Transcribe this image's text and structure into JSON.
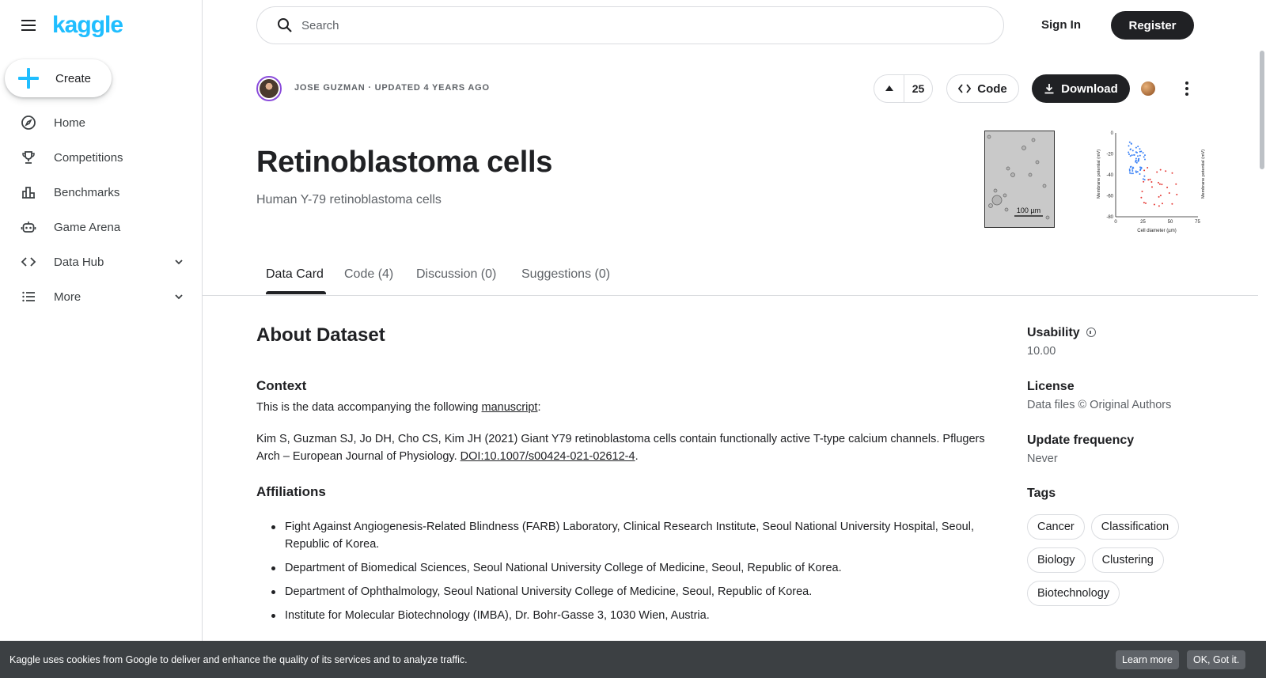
{
  "app": {
    "logo": "kaggle"
  },
  "sidebar": {
    "create_label": "Create",
    "items": [
      {
        "label": "Home",
        "icon": "compass-icon"
      },
      {
        "label": "Competitions",
        "icon": "trophy-icon"
      },
      {
        "label": "Benchmarks",
        "icon": "bar-chart-icon"
      },
      {
        "label": "Game Arena",
        "icon": "robot-icon"
      },
      {
        "label": "Data Hub",
        "icon": "code-icon",
        "expandable": true
      },
      {
        "label": "More",
        "icon": "list-icon",
        "expandable": true
      }
    ]
  },
  "topbar": {
    "search_placeholder": "Search",
    "signin_label": "Sign In",
    "register_label": "Register"
  },
  "dataset": {
    "author": "JOSE GUZMAN",
    "updated": "· UPDATED 4 YEARS AGO",
    "upvotes": "25",
    "code_label": "Code",
    "download_label": "Download",
    "title": "Retinoblastoma cells",
    "subtitle": "Human Y-79 retinoblastoma cells",
    "thumb_scale_label": "100 µm",
    "thumb_chart": {
      "ylabel": "Membrane potential (mV)",
      "xlabel": "Cell diameter (µm)",
      "yticks": [
        "0",
        "-20",
        "-40",
        "-60",
        "-80"
      ],
      "xticks": [
        "0",
        "25",
        "50",
        "75"
      ],
      "colors": {
        "blue": "#3b82f6",
        "red": "#e53935"
      }
    }
  },
  "tabs": [
    {
      "label": "Data Card",
      "active": true
    },
    {
      "label": "Code (4)",
      "active": false
    },
    {
      "label": "Discussion (0)",
      "active": false
    },
    {
      "label": "Suggestions (0)",
      "active": false
    }
  ],
  "about": {
    "heading": "About Dataset",
    "context_heading": "Context",
    "context_text_before": "This is the data accompanying the following ",
    "context_link": "manuscript",
    "context_text_after": ":",
    "citation_text": "Kim S, Guzman SJ, Jo DH, Cho CS, Kim JH (2021) Giant Y79 retinoblastoma cells contain functionally active T-type calcium channels. Pflugers Arch – European Journal of Physiology. ",
    "citation_link": "DOI:10.1007/s00424-021-02612-4",
    "citation_end": ".",
    "affiliations_heading": "Affiliations",
    "affiliations": [
      "Fight Against Angiogenesis-Related Blindness (FARB) Laboratory, Clinical Research Institute, Seoul National University Hospital, Seoul, Republic of Korea.",
      "Department of Biomedical Sciences, Seoul National University College of Medicine, Seoul, Republic of Korea.",
      "Department of Ophthalmology, Seoul National University College of Medicine, Seoul, Republic of Korea.",
      "Institute for Molecular Biotechnology (IMBA), Dr. Bohr-Gasse 3, 1030 Wien, Austria."
    ]
  },
  "meta": {
    "usability_label": "Usability",
    "usability_value": "10.00",
    "license_label": "License",
    "license_value": "Data files © Original Authors",
    "update_label": "Update frequency",
    "update_value": "Never",
    "tags_label": "Tags",
    "tags": [
      "Cancer",
      "Classification",
      "Biology",
      "Clustering",
      "Biotechnology"
    ]
  },
  "cookie": {
    "text": "Kaggle uses cookies from Google to deliver and enhance the quality of its services and to analyze traffic.",
    "learn_more": "Learn more",
    "ok": "OK, Got it."
  },
  "colors": {
    "accent": "#20beff",
    "dark": "#202124",
    "cookie_bg": "#3c4043"
  }
}
